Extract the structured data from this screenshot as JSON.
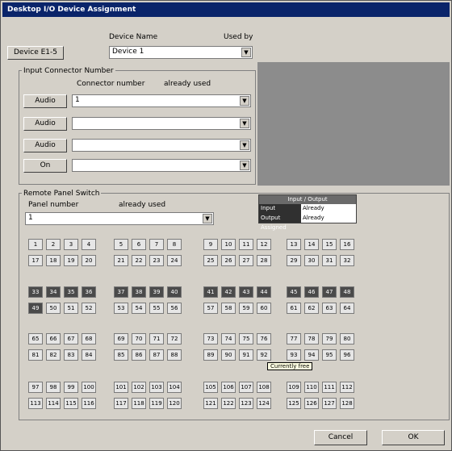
{
  "window": {
    "title": "Desktop I/O Device Assignment"
  },
  "top": {
    "device_button": "Device E1-5",
    "col_type_label": "Device Name",
    "col_used_label": "Used by",
    "device_value": "Device 1"
  },
  "connectors": {
    "group_label": "Input Connector Number",
    "col_number": "Connector number",
    "col_used": "already used",
    "rows": [
      {
        "button": "Audio",
        "value": "1"
      },
      {
        "button": "Audio",
        "value": ""
      },
      {
        "button": "Audio",
        "value": ""
      },
      {
        "button": "On",
        "value": ""
      }
    ]
  },
  "routing": {
    "group_label": "Remote Panel Switch",
    "col_number": "Panel number",
    "col_used": "already used",
    "value": "1"
  },
  "legend": {
    "header": "Input / Output",
    "rows": [
      {
        "key": "Input Assigned",
        "val": "Already"
      },
      {
        "key": "Output Assigned",
        "val": "Already"
      }
    ]
  },
  "tooltip": "Currently free",
  "buttons": {
    "cancel": "Cancel",
    "ok": "OK"
  }
}
